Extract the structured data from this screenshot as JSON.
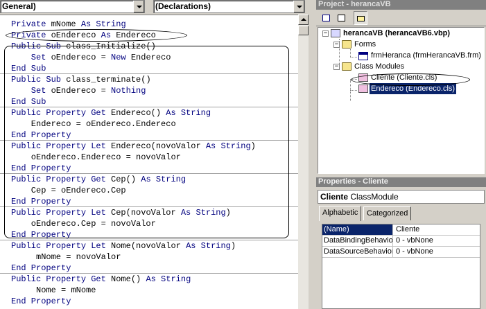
{
  "code_window": {
    "object_combo": "General)",
    "procedure_combo": "(Declarations)",
    "lines": [
      [
        {
          "t": "Private ",
          "k": true
        },
        {
          "t": "mNome "
        },
        {
          "t": "As String",
          "k": true
        }
      ],
      [
        {
          "t": "Private ",
          "k": true
        },
        {
          "t": "oEndereco "
        },
        {
          "t": "As ",
          "k": true
        },
        {
          "t": "Endereco"
        }
      ],
      [
        {
          "t": "Public Sub ",
          "k": true
        },
        {
          "t": "class_Initialize()"
        }
      ],
      [
        {
          "t": "    Set ",
          "k": true
        },
        {
          "t": "oEndereco = "
        },
        {
          "t": "New ",
          "k": true
        },
        {
          "t": "Endereco"
        }
      ],
      [
        {
          "t": "End Sub",
          "k": true
        }
      ],
      [
        {
          "t": "Public Sub ",
          "k": true
        },
        {
          "t": "class_terminate()"
        }
      ],
      [
        {
          "t": "    Set ",
          "k": true
        },
        {
          "t": "oEndereco = "
        },
        {
          "t": "Nothing",
          "k": true
        }
      ],
      [
        {
          "t": "End Sub",
          "k": true
        }
      ],
      [
        {
          "t": "Public Property Get ",
          "k": true
        },
        {
          "t": "Endereco() "
        },
        {
          "t": "As String",
          "k": true
        }
      ],
      [
        {
          "t": "    Endereco = oEndereco.Endereco"
        }
      ],
      [
        {
          "t": "End Property",
          "k": true
        }
      ],
      [
        {
          "t": "Public Property Let ",
          "k": true
        },
        {
          "t": "Endereco(novoValor "
        },
        {
          "t": "As String",
          "k": true
        },
        {
          "t": ")"
        }
      ],
      [
        {
          "t": "    oEndereco.Endereco = novoValor"
        }
      ],
      [
        {
          "t": "End Property",
          "k": true
        }
      ],
      [
        {
          "t": "Public Property Get ",
          "k": true
        },
        {
          "t": "Cep() "
        },
        {
          "t": "As String",
          "k": true
        }
      ],
      [
        {
          "t": "    Cep = oEndereco.Cep"
        }
      ],
      [
        {
          "t": "End Property",
          "k": true
        }
      ],
      [
        {
          "t": "Public Property Let ",
          "k": true
        },
        {
          "t": "Cep(novoValor "
        },
        {
          "t": "As String",
          "k": true
        },
        {
          "t": ")"
        }
      ],
      [
        {
          "t": "    oEndereco.Cep = novoValor"
        }
      ],
      [
        {
          "t": "End Property",
          "k": true
        }
      ],
      [
        {
          "t": "Public Property Let ",
          "k": true
        },
        {
          "t": "Nome(novoValor "
        },
        {
          "t": "As String",
          "k": true
        },
        {
          "t": ")"
        }
      ],
      [
        {
          "t": "     mNome = novoValor"
        }
      ],
      [
        {
          "t": "End Property",
          "k": true
        }
      ],
      [
        {
          "t": "Public Property Get ",
          "k": true
        },
        {
          "t": "Nome() "
        },
        {
          "t": "As String",
          "k": true
        }
      ],
      [
        {
          "t": "     Nome = mNome"
        }
      ],
      [
        {
          "t": "End Property",
          "k": true
        }
      ]
    ]
  },
  "project_explorer": {
    "title": "Project - herancaVB",
    "project_node": "herancaVB (herancaVB6.vbp)",
    "forms_folder": "Forms",
    "form_item": "frmHeranca (frmHerancaVB.frm)",
    "class_folder": "Class Modules",
    "class_items": [
      "Cliente (Cliente.cls)",
      "Endereco (Endereco.cls)"
    ]
  },
  "properties": {
    "title": "Properties - Cliente",
    "object_name": "Cliente",
    "object_type": "ClassModule",
    "tabs": [
      "Alphabetic",
      "Categorized"
    ],
    "rows": [
      {
        "name": "(Name)",
        "value": "Cliente"
      },
      {
        "name": "DataBindingBehavior",
        "value": "0 - vbNone"
      },
      {
        "name": "DataSourceBehavior",
        "value": "0 - vbNone"
      }
    ]
  },
  "colors": {
    "keyword": "#00007f",
    "selection": "#0a246a",
    "title_bar": "#808080"
  }
}
